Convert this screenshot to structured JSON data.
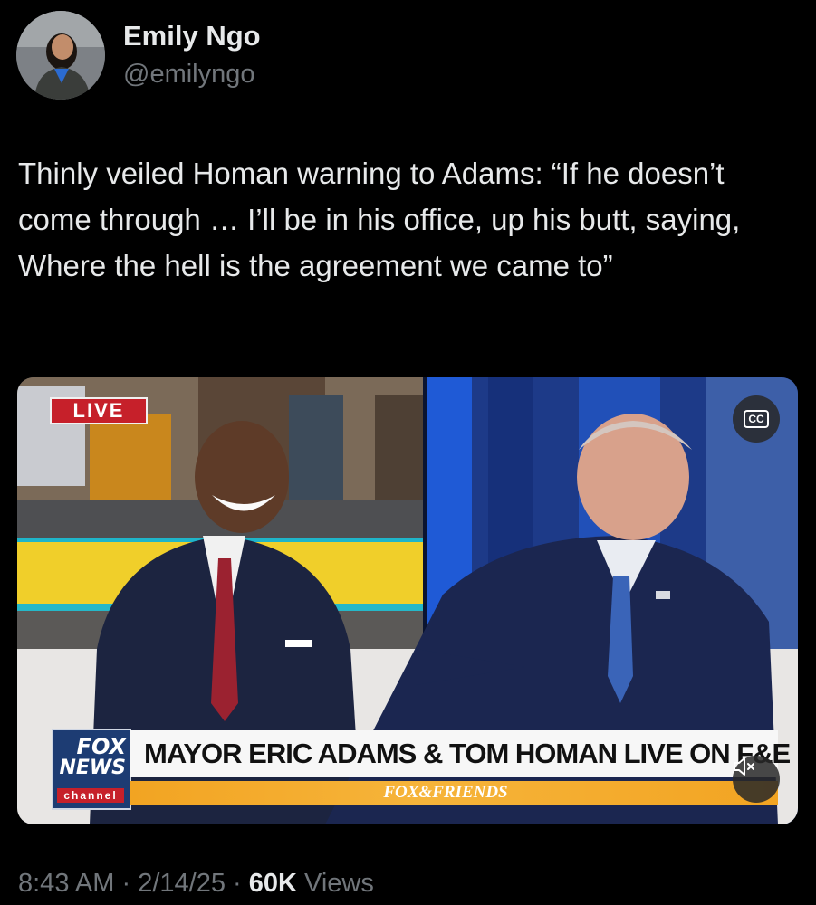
{
  "author": {
    "display_name": "Emily Ngo",
    "handle": "@emilyngo"
  },
  "tweet": {
    "text": "Thinly veiled Homan warning to Adams: “If he doesn’t come through … I’ll be in his office, up his butt, saying, Where the hell is the agreement we came to”"
  },
  "media": {
    "live_label": "LIVE",
    "cc_label": "CC",
    "cc_icon": "closed-captions-icon",
    "mute_icon": "speaker-muted-icon",
    "network_logo": {
      "line1": "FOX",
      "line2": "NEWS",
      "line3": "channel"
    },
    "chyron_text": "MAYOR ERIC ADAMS & TOM HOMAN LIVE ON F&E",
    "show_name": "FOX&FRIENDS"
  },
  "meta": {
    "time": "8:43 AM",
    "date": "2/14/25",
    "view_count": "60K",
    "views_label": "Views",
    "separator": "·"
  },
  "colors": {
    "background": "#000000",
    "primary_text": "#e7e9ea",
    "secondary_text": "#71767b",
    "live_red": "#c6202a",
    "fox_blue": "#1d3c73",
    "chyron_orange": "#f2a422"
  }
}
